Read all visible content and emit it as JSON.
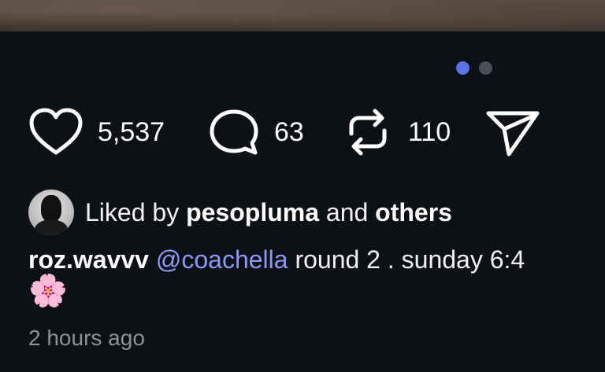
{
  "post": {
    "carousel": {
      "total": 2,
      "active_index": 0
    },
    "actions": {
      "likes": "5,537",
      "comments": "63",
      "reposts": "110"
    },
    "liked_by": {
      "prefix": "Liked by",
      "user": "pesopluma",
      "joiner": "and",
      "others": "others"
    },
    "caption": {
      "username": "roz.wavvv",
      "mention": "@coachella",
      "text": "round 2 . sunday 6:4",
      "emoji": "🌸"
    },
    "timestamp": "2 hours ago"
  },
  "colors": {
    "background": "#0d1014",
    "accent": "#5b73e8",
    "mention": "#8a9af5",
    "muted": "#8e9297"
  }
}
